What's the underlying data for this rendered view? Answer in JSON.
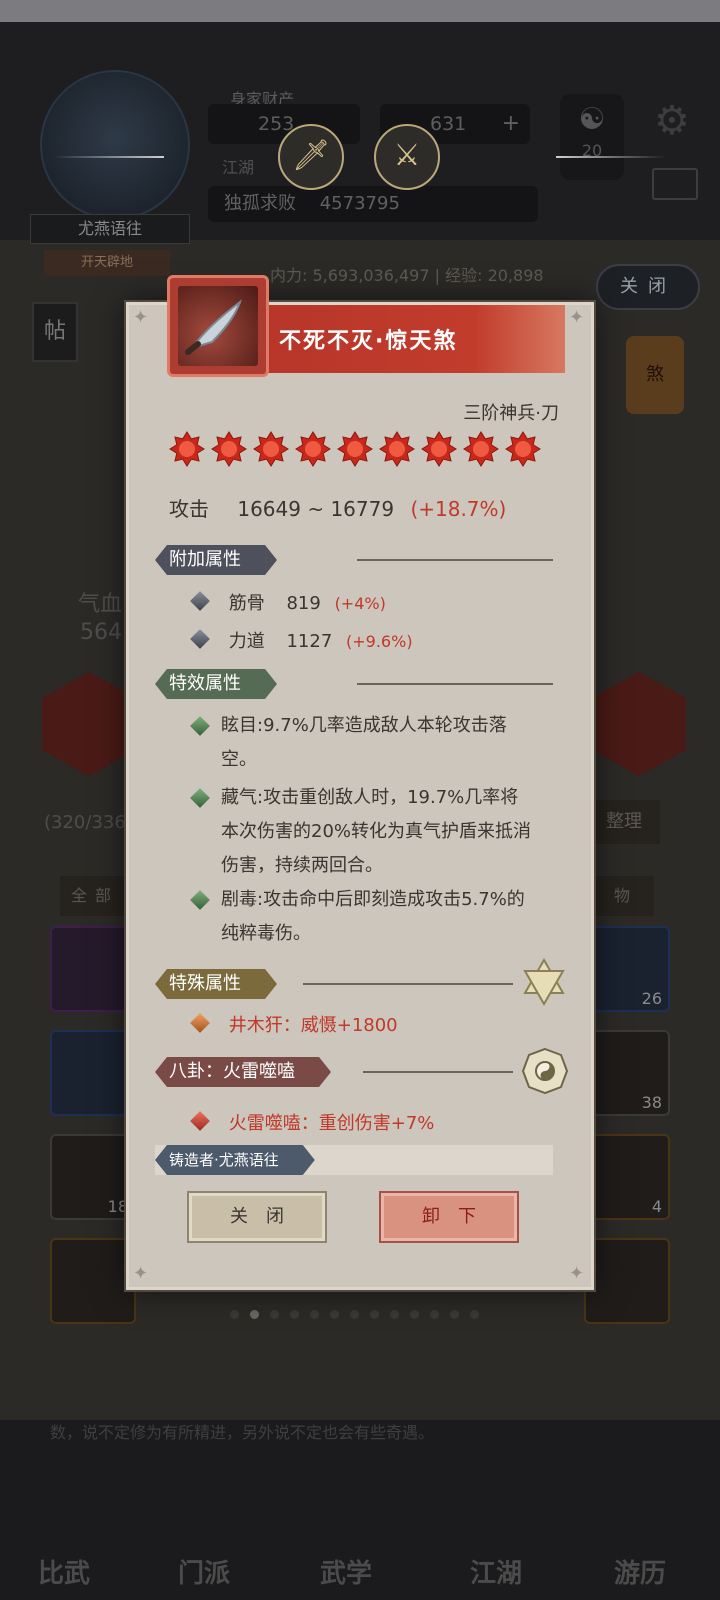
{
  "background": {
    "player_name": "尤燕语往",
    "player_title": "开天辟地",
    "resource_label": "身家财产",
    "gold_value": "253",
    "gem_value": "631",
    "line_label": "江湖",
    "power_label": "独孤求败",
    "power_value": "4573795",
    "yinyang_value": "20",
    "stats_line": "内力: 5,693,036,497 | 经验: 20,898",
    "close_label": "关闭",
    "tie_label": "帖",
    "emblem_label": "煞",
    "hp_label": "气血",
    "hp_value": "564",
    "bag_count": "(320/336",
    "sort_label": "整理",
    "filter_all": "全部",
    "filter_item": "物",
    "slot_qty": [
      "26",
      "38",
      "18",
      "4"
    ],
    "desc_line1": "数，说不定修为有所精进，另外说不定也会有些奇遇。",
    "nav": [
      "比武",
      "门派",
      "武学",
      "江湖",
      "游历"
    ]
  },
  "dialog": {
    "item_name": "不死不灭·惊天煞",
    "grade": "三阶神兵·刀",
    "star_count": 9,
    "attack_label": "攻击",
    "attack_range": "16649 ~ 16779",
    "attack_bonus": "(+18.7%)",
    "sections": {
      "extra": "附加属性",
      "effect": "特效属性",
      "special": "特殊属性",
      "bagua": "八卦：火雷噬嗑",
      "forger": "铸造者·尤燕语往"
    },
    "extra_attrs": [
      {
        "name": "筋骨",
        "value": "819",
        "bonus": "(+4%)"
      },
      {
        "name": "力道",
        "value": "1127",
        "bonus": "(+9.6%)"
      }
    ],
    "effects": [
      "眩目:9.7%几率造成敌人本轮攻击落空。",
      "藏气:攻击重创敌人时，19.7%几率将本次伤害的20%转化为真气护盾来抵消伤害，持续两回合。",
      "剧毒:攻击命中后即刻造成攻击5.7%的纯粹毒伤。"
    ],
    "special_attr": "井木犴：威慑+1800",
    "bagua_attr": "火雷噬嗑：重创伤害+7%",
    "close_button": "关闭",
    "unequip_button": "卸下"
  },
  "colors": {
    "title_red": "#c23c2c",
    "bonus_red": "#c0392b",
    "dialog_bg": "#ccc6bd"
  }
}
